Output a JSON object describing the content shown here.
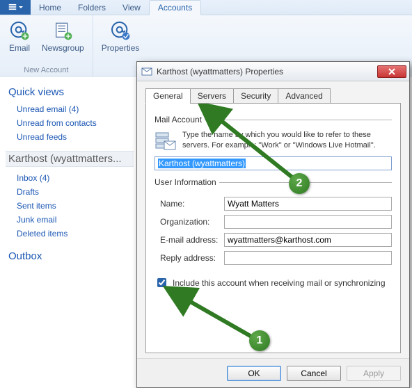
{
  "ribbon": {
    "tabs": [
      "Home",
      "Folders",
      "View",
      "Accounts"
    ],
    "active_index": 3,
    "buttons": {
      "email": "Email",
      "newsgroup": "Newsgroup",
      "properties": "Properties"
    },
    "group_label": "New Account"
  },
  "sidebar": {
    "quick_head": "Quick views",
    "quick": [
      {
        "label": "Unread email",
        "count": "(4)"
      },
      {
        "label": "Unread from contacts",
        "count": ""
      },
      {
        "label": "Unread feeds",
        "count": ""
      }
    ],
    "account_head": "Karthost (wyattmatters...",
    "folders": [
      {
        "label": "Inbox",
        "count": "(4)"
      },
      {
        "label": "Drafts",
        "count": ""
      },
      {
        "label": "Sent items",
        "count": ""
      },
      {
        "label": "Junk email",
        "count": ""
      },
      {
        "label": "Deleted items",
        "count": ""
      }
    ],
    "outbox_head": "Outbox"
  },
  "dialog": {
    "title": "Karthost (wyattmatters) Properties",
    "tabs": [
      "General",
      "Servers",
      "Security",
      "Advanced"
    ],
    "active_tab": 0,
    "mail_account": {
      "legend": "Mail Account",
      "desc": "Type the name by which you would like to refer to these servers.  For example: \"Work\" or \"Windows Live Hotmail\".",
      "value": "Karthost (wyattmatters)"
    },
    "user_info": {
      "legend": "User Information",
      "name_label": "Name:",
      "name_value": "Wyatt Matters",
      "org_label": "Organization:",
      "org_value": "",
      "email_label": "E-mail address:",
      "email_value": "wyattmatters@karthost.com",
      "reply_label": "Reply address:",
      "reply_value": ""
    },
    "include_label": "Include this account when receiving mail or synchronizing",
    "buttons": {
      "ok": "OK",
      "cancel": "Cancel",
      "apply": "Apply"
    }
  },
  "annotations": {
    "badge1": "1",
    "badge2": "2"
  }
}
